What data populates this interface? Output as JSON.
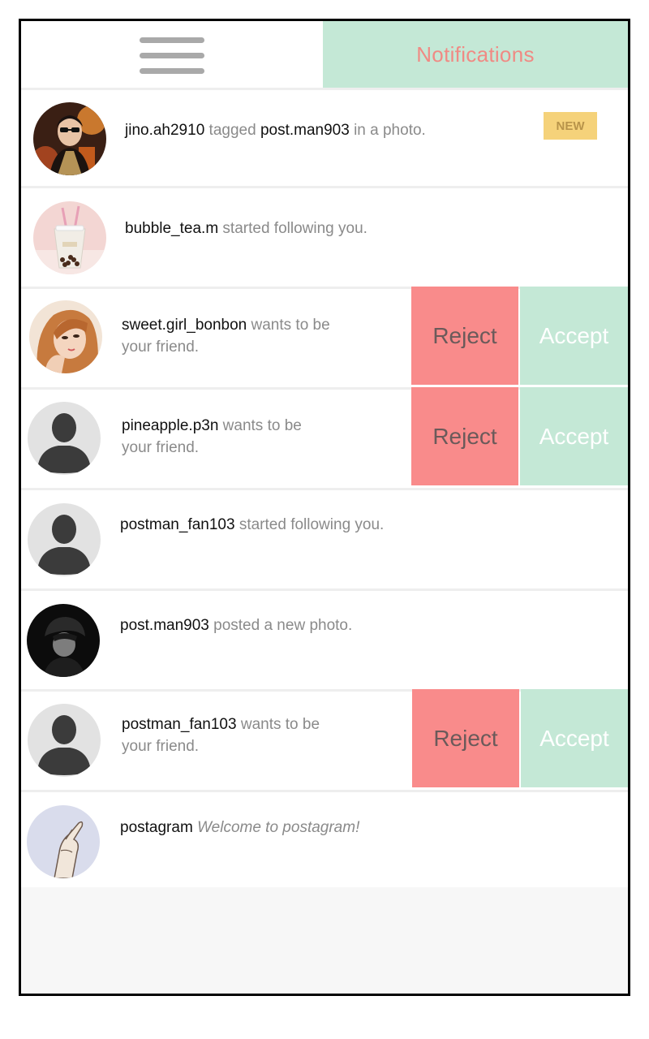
{
  "header": {
    "tab_label": "Notifications"
  },
  "notifications": [
    {
      "user": "jino.ah2910",
      "text_a": " tagged ",
      "user2": "post.man903",
      "text_b": " in a photo.",
      "badge": "NEW"
    },
    {
      "user": "bubble_tea.m",
      "text": " started following you."
    },
    {
      "user": "sweet.girl_bonbon",
      "text_line1": " wants to be",
      "text_line2": "your friend.",
      "reject": "Reject",
      "accept": "Accept"
    },
    {
      "user": "pineapple.p3n",
      "text_line1": " wants to be",
      "text_line2": "your friend.",
      "reject": "Reject",
      "accept": "Accept"
    },
    {
      "user": "postman_fan103",
      "text": " started following you."
    },
    {
      "user": "post.man903",
      "text": " posted a new photo."
    },
    {
      "user": "postman_fan103",
      "text_line1": " wants to be",
      "text_line2": "your friend.",
      "reject": "Reject",
      "accept": "Accept"
    },
    {
      "user": "postagram",
      "text": "Welcome to postagram!"
    }
  ],
  "colors": {
    "accent_green": "#c4e8d6",
    "reject_red": "#f98b8b",
    "title_pink": "#f08a84",
    "badge_yellow": "#f5d27a"
  }
}
